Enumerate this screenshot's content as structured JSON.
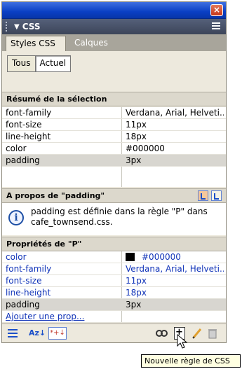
{
  "window": {
    "close_label": "×"
  },
  "panel": {
    "title": "CSS"
  },
  "tabs": [
    {
      "label": "Styles CSS"
    },
    {
      "label": "Calques"
    }
  ],
  "mode": {
    "all_label": "Tous",
    "current_label": "Actuel",
    "selected": "Actuel"
  },
  "summary": {
    "title": "Résumé de la sélection",
    "rows": [
      {
        "name": "font-family",
        "value": "Verdana, Arial, Helveti..."
      },
      {
        "name": "font-size",
        "value": "11px"
      },
      {
        "name": "line-height",
        "value": "18px"
      },
      {
        "name": "color",
        "value": "#000000"
      },
      {
        "name": "padding",
        "value": "3px"
      }
    ]
  },
  "about": {
    "title": "A propos de \"padding\"",
    "text": "padding est définie dans la règle \"P\" dans cafe_townsend.css."
  },
  "properties": {
    "title": "Propriétés de \"P\"",
    "rows": [
      {
        "name": "color",
        "value": "#000000",
        "swatch": "#000000"
      },
      {
        "name": "font-family",
        "value": "Verdana, Arial, Helveti..."
      },
      {
        "name": "font-size",
        "value": "11px"
      },
      {
        "name": "line-height",
        "value": "18px"
      },
      {
        "name": "padding",
        "value": "3px"
      }
    ],
    "add_label": "Ajouter une prop..."
  },
  "toolbar": {
    "alpha_label": "Az↓",
    "setonly_label": "*+↓",
    "tooltip": "Nouvelle règle de CSS"
  },
  "colors": {
    "link_blue": "#1033b8",
    "titlebar_blue": "#0a3fc4",
    "panel_bg": "#ede9dd"
  }
}
